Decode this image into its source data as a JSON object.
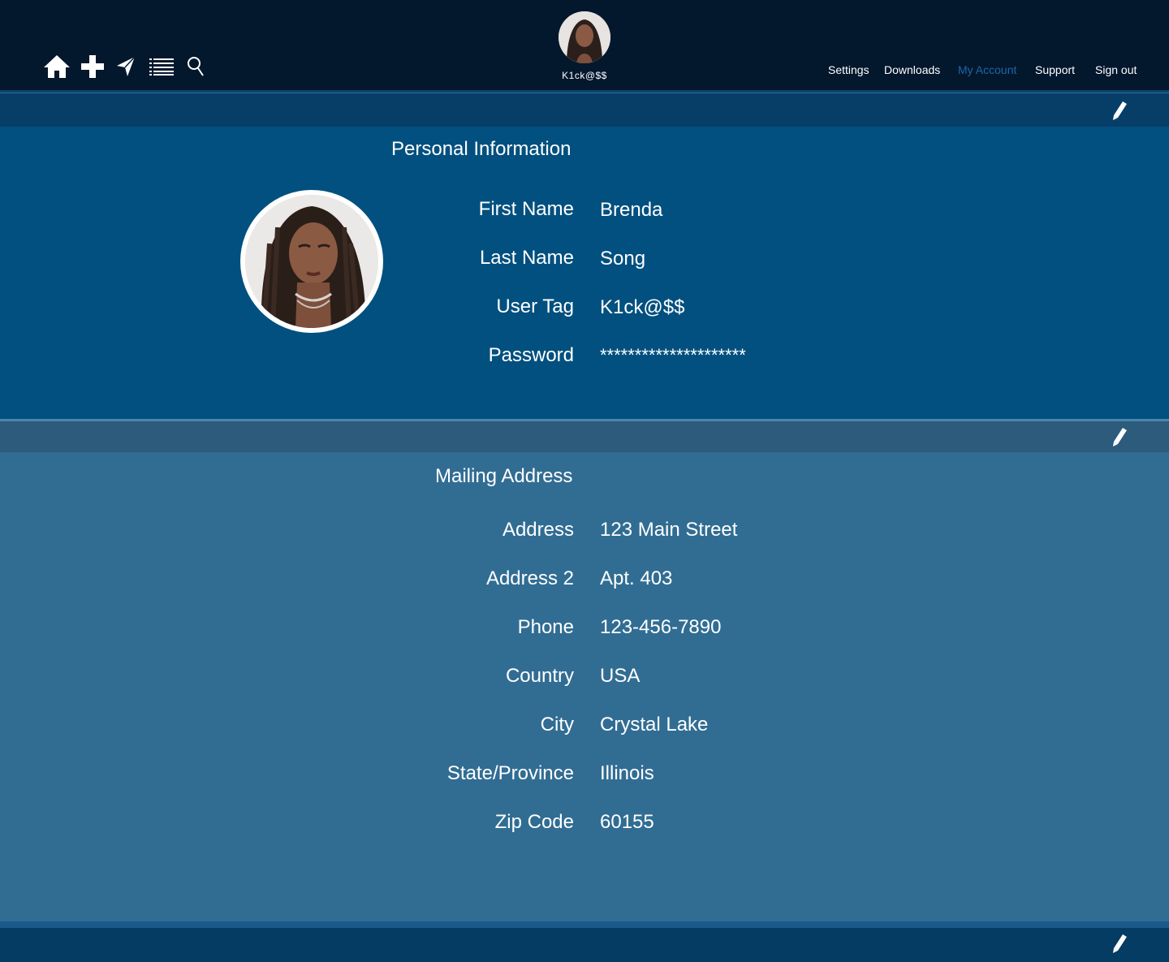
{
  "toolbar": {
    "icons": [
      "home-icon",
      "plus-icon",
      "send-icon",
      "list-icon",
      "search-icon"
    ]
  },
  "user": {
    "tag": "K1ck@$$"
  },
  "nav": {
    "items": [
      {
        "label": "Settings",
        "active": false
      },
      {
        "label": "Downloads",
        "active": false
      },
      {
        "label": "My Account",
        "active": true
      },
      {
        "label": "Support",
        "active": false
      },
      {
        "label": "Sign out",
        "active": false
      }
    ]
  },
  "personal": {
    "title": "Personal Information",
    "fields": [
      {
        "label": "First Name",
        "value": "Brenda"
      },
      {
        "label": "Last Name",
        "value": "Song"
      },
      {
        "label": "User Tag",
        "value": "K1ck@$$"
      },
      {
        "label": "Password",
        "value": "*********************"
      }
    ]
  },
  "mailing": {
    "title": "Mailing Address",
    "fields": [
      {
        "label": "Address",
        "value": "123 Main Street"
      },
      {
        "label": "Address 2",
        "value": "Apt. 403"
      },
      {
        "label": "Phone",
        "value": "123-456-7890"
      },
      {
        "label": "Country",
        "value": "USA"
      },
      {
        "label": "City",
        "value": "Crystal Lake"
      },
      {
        "label": "State/Province",
        "value": "Illinois"
      },
      {
        "label": "Zip Code",
        "value": "60155"
      }
    ]
  },
  "colors": {
    "topbar": "#03172d",
    "personal_bg": "#02507f",
    "mailing_bg": "#316d93",
    "active_nav": "#1c67a8"
  }
}
